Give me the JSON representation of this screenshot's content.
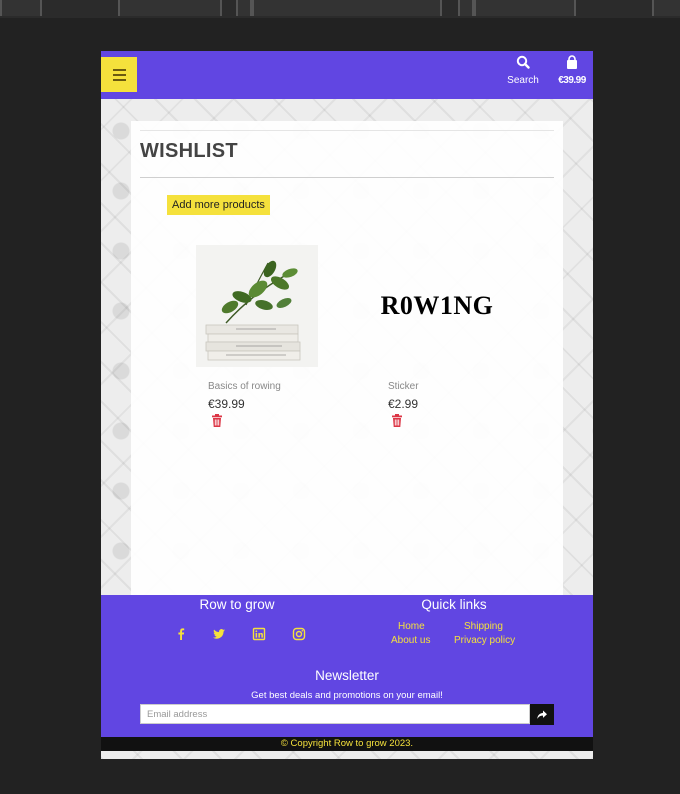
{
  "navbar": {
    "menu_icon": "hamburger-icon",
    "search_label": "Search",
    "search_icon": "search-icon",
    "cart_total": "€39.99",
    "cart_icon": "shopping-bag-icon"
  },
  "wishlist": {
    "title": "WISHLIST",
    "add_button": "Add more products",
    "items": [
      {
        "name": "Basics of rowing",
        "price": "€39.99",
        "image": "plant-on-books",
        "remove_icon": "trash-icon"
      },
      {
        "name": "Sticker",
        "price": "€2.99",
        "image_text": "R0W1NG",
        "remove_icon": "trash-icon"
      }
    ]
  },
  "footer": {
    "brand": "Row to grow",
    "social_icons": [
      "facebook-icon",
      "twitter-icon",
      "linkedin-icon",
      "instagram-icon"
    ],
    "quick_links_title": "Quick links",
    "links": {
      "home": "Home",
      "shipping": "Shipping",
      "about": "About us",
      "privacy": "Privacy policy"
    },
    "newsletter_title": "Newsletter",
    "newsletter_text": "Get best deals and promotions on your email!",
    "email_placeholder": "Email address",
    "send_icon": "share-arrow-icon",
    "copyright": "© Copyright Row to grow 2023."
  },
  "colors": {
    "brand_purple": "#6146e2",
    "accent_yellow": "#f5e13c",
    "delete_red": "#dc3545"
  }
}
